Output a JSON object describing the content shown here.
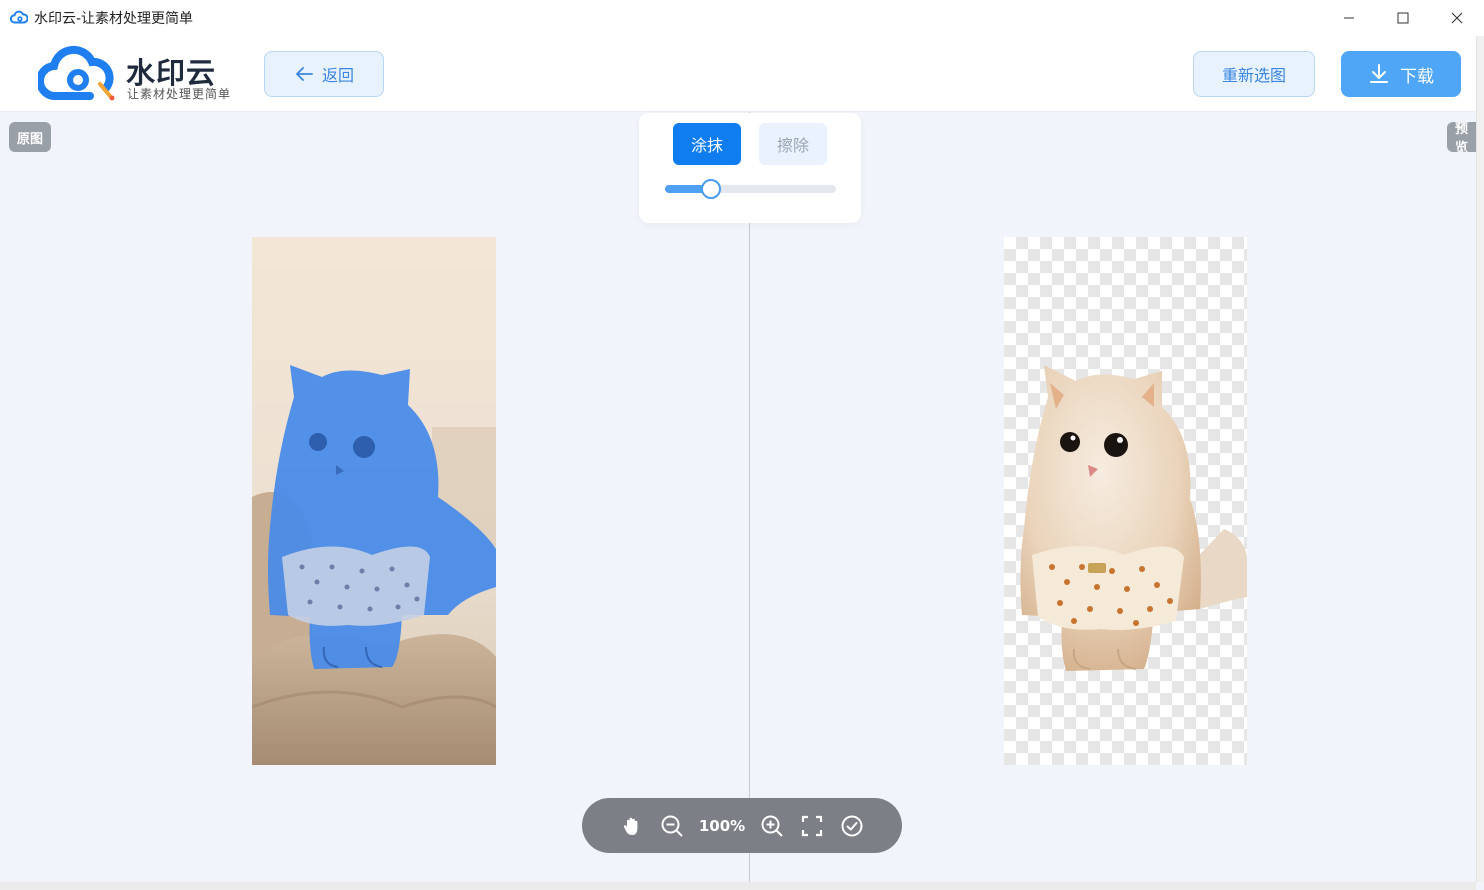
{
  "window": {
    "title": "水印云-让素材处理更简单",
    "minimize_icon": "minimize-icon",
    "maximize_icon": "maximize-icon",
    "close_icon": "close-icon"
  },
  "header": {
    "brand": "水印云",
    "slogan": "让素材处理更简单",
    "back_label": "返回",
    "reselect_label": "重新选图",
    "download_label": "下载",
    "accent_color": "#4fa6f7"
  },
  "canvas": {
    "left_tag": "原图",
    "right_tag": "预览"
  },
  "brush": {
    "paint_label": "涂抹",
    "erase_label": "擦除",
    "active_mode": "涂抹",
    "brush_size_fraction": 0.27
  },
  "toolbar": {
    "zoom": "100%",
    "icons": [
      "hand-icon",
      "zoom-out-icon",
      "zoom-in-icon",
      "fit-screen-icon",
      "confirm-icon"
    ]
  }
}
